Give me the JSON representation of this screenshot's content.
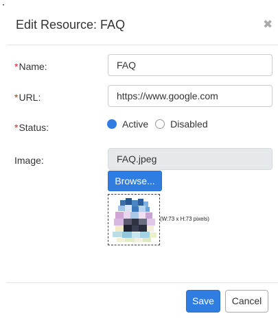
{
  "dialog": {
    "title": "Edit Resource: FAQ",
    "close_glyph": "✖"
  },
  "form": {
    "required_mark": "*",
    "name": {
      "label": "Name:",
      "value": "FAQ"
    },
    "url": {
      "label": "URL:",
      "value": "https://www.google.com"
    },
    "status": {
      "label": "Status:",
      "options": [
        "Active",
        "Disabled"
      ],
      "selected": "Active"
    },
    "image": {
      "label": "Image:",
      "file_name": "FAQ.jpeg",
      "browse_label": "Browse...",
      "preview_dimensions": "(W:73 x H:73 pixels)"
    }
  },
  "footer": {
    "save_label": "Save",
    "cancel_label": "Cancel"
  },
  "colors": {
    "primary": "#2f7de1",
    "required": "#e02020",
    "readonly_bg": "#e6e9ec"
  },
  "icons": {
    "close": "close-icon",
    "preview": "faq-thumbnail-image"
  }
}
